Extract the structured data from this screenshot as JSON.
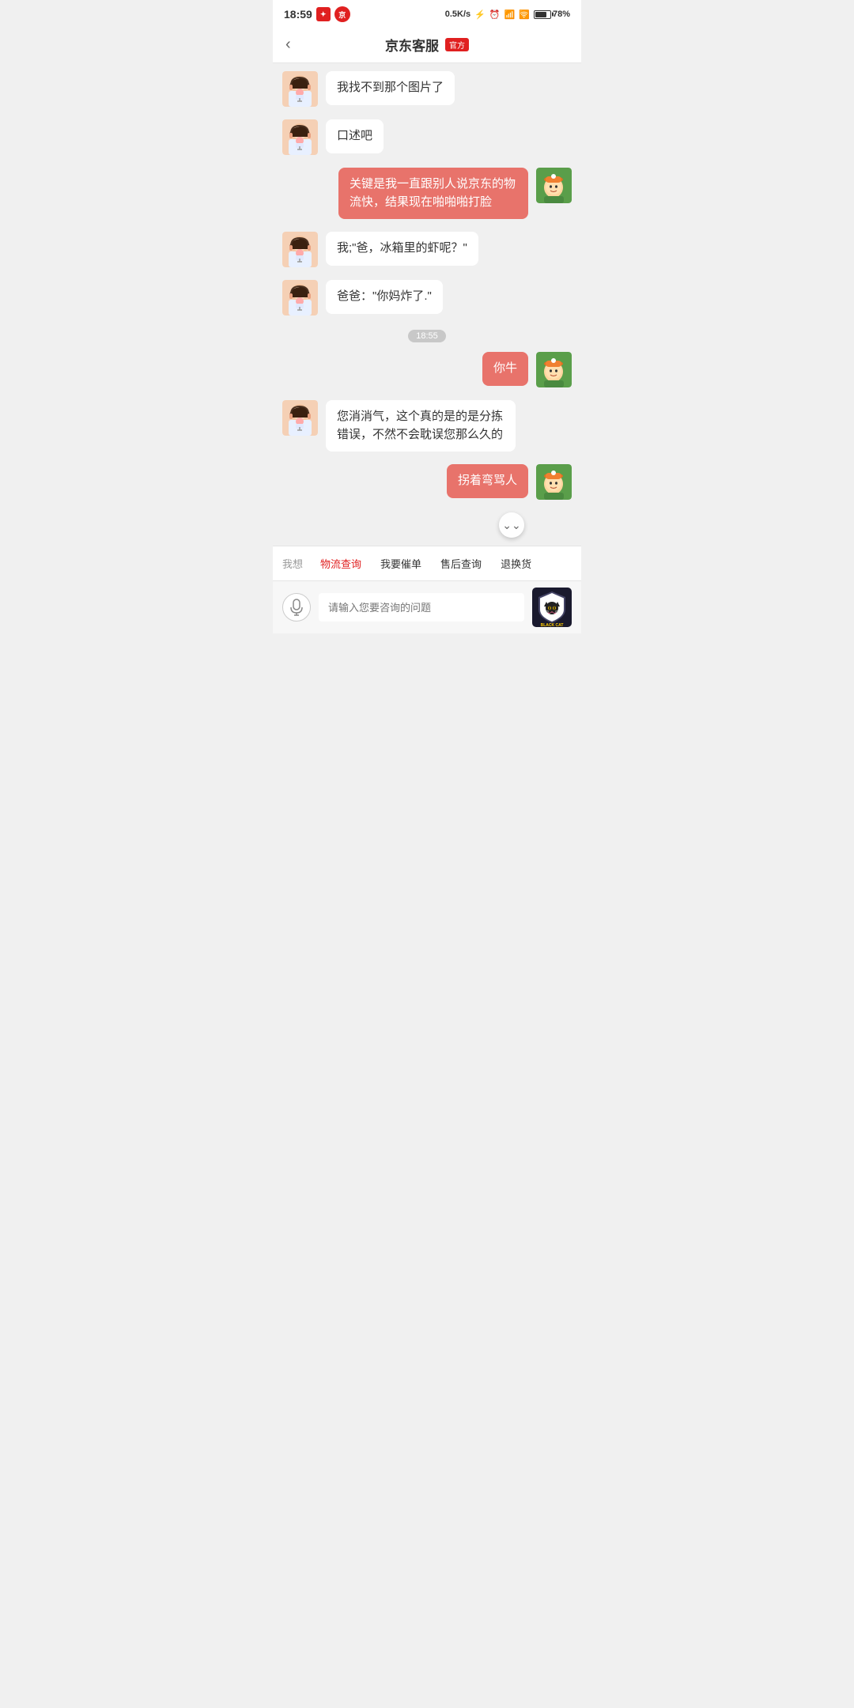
{
  "statusBar": {
    "time": "18:59",
    "network": "0.5K/s",
    "battery": "78%"
  },
  "header": {
    "title": "京东客服",
    "badge": "官方",
    "backLabel": "‹"
  },
  "messages": [
    {
      "id": 1,
      "type": "agent",
      "text": "我找不到那个图片了"
    },
    {
      "id": 2,
      "type": "agent",
      "text": "口述吧"
    },
    {
      "id": 3,
      "type": "user",
      "text": "关键是我一直跟别人说京东的物流快，结果现在啪啪啪打脸"
    },
    {
      "id": 4,
      "type": "agent",
      "text": "我;\"爸，冰箱里的虾呢？\""
    },
    {
      "id": 5,
      "type": "agent",
      "text": "爸爸：\"你妈炸了.\""
    },
    {
      "id": 6,
      "type": "timestamp",
      "text": "18:55"
    },
    {
      "id": 7,
      "type": "user",
      "text": "你牛"
    },
    {
      "id": 8,
      "type": "agent",
      "text": "您消消气，这个真的是的是分拣错误，不然不会耽误您那么久的"
    },
    {
      "id": 9,
      "type": "user",
      "text": "拐着弯骂人"
    }
  ],
  "quickReplies": {
    "label": "我想",
    "items": [
      {
        "id": 1,
        "text": "物流查询",
        "active": true
      },
      {
        "id": 2,
        "text": "我要催单",
        "active": false
      },
      {
        "id": 3,
        "text": "售后查询",
        "active": false
      },
      {
        "id": 4,
        "text": "退换货",
        "active": false
      }
    ]
  },
  "inputBar": {
    "placeholder": "请输入您要咨询的问题",
    "micLabel": "🎤",
    "blackcatText": "BLACK CAT"
  }
}
